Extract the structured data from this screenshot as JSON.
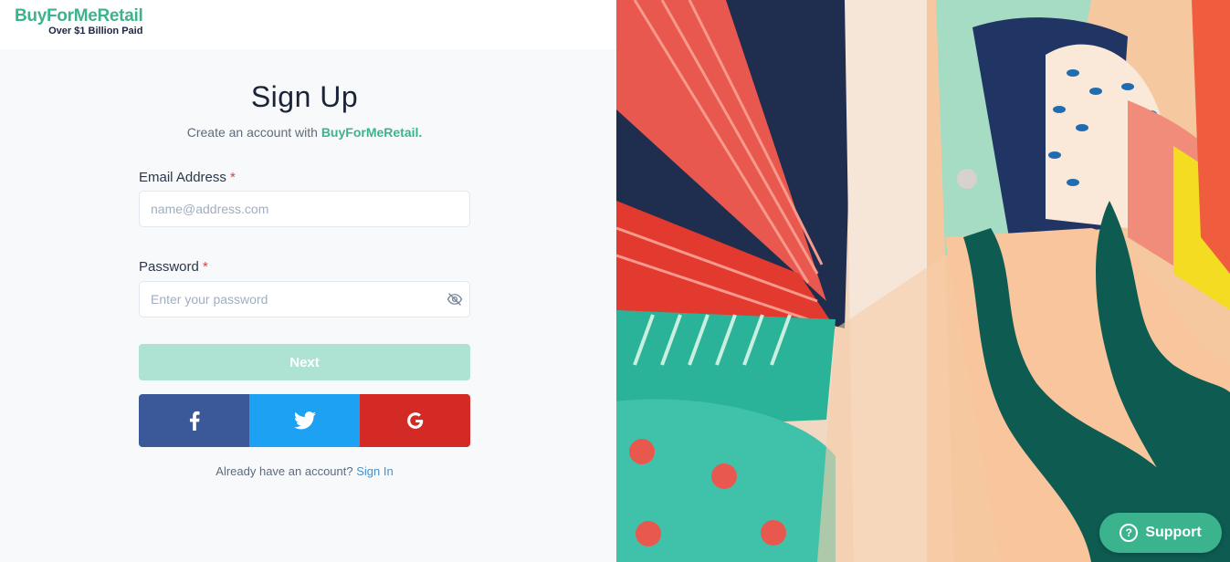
{
  "brand": {
    "name": "BuyForMeRetail",
    "tagline": "Over $1 Billion Paid",
    "color": "#3bb48e"
  },
  "signup": {
    "title": "Sign Up",
    "subtitle_prefix": "Create an account with ",
    "subtitle_brand": "BuyForMeRetail."
  },
  "email": {
    "label": "Email Address",
    "required_mark": "*",
    "placeholder": "name@address.com",
    "value": ""
  },
  "password": {
    "label": "Password",
    "required_mark": "*",
    "placeholder": "Enter your password",
    "value": "",
    "toggle_icon": "eye-off-icon"
  },
  "next_button": {
    "label": "Next",
    "color": "#aee3d3"
  },
  "social": [
    {
      "name": "facebook",
      "icon": "facebook-icon",
      "color": "#3b5998"
    },
    {
      "name": "twitter",
      "icon": "twitter-icon",
      "color": "#1da1f2"
    },
    {
      "name": "google",
      "icon": "google-icon",
      "color": "#d42a26"
    }
  ],
  "signin": {
    "prompt": "Already have an account? ",
    "link": "Sign In"
  },
  "support_button": {
    "label": "Support",
    "icon": "question-circle-icon"
  }
}
